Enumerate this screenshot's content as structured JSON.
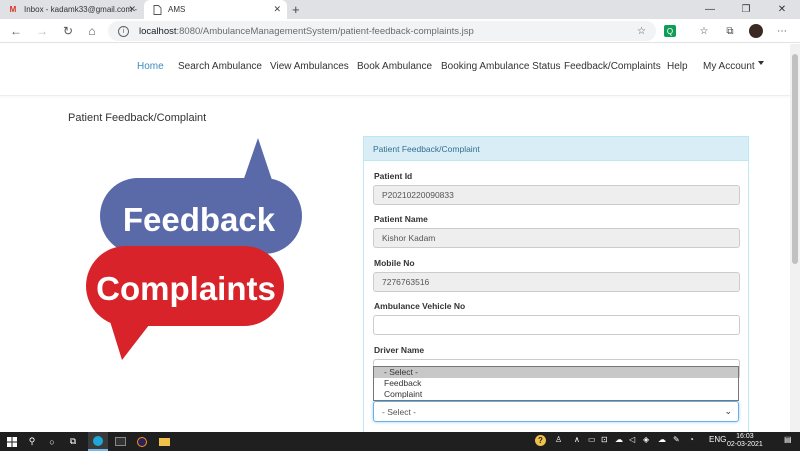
{
  "browser": {
    "tabs": [
      {
        "title": "Inbox - kadamk33@gmail.com -",
        "icon": "gmail-icon",
        "active": false
      },
      {
        "title": "AMS",
        "icon": "page-icon",
        "active": true
      }
    ],
    "url_host": "localhost",
    "url_path": ":8080/AmbulanceManagementSystem/patient-feedback-complaints.jsp"
  },
  "nav": {
    "items": [
      "Home",
      "Search Ambulance",
      "View Ambulances",
      "Book Ambulance",
      "Booking Ambulance Status",
      "Feedback/Complaints",
      "Help",
      "My Account"
    ],
    "active_index": 0
  },
  "page": {
    "title": "Patient Feedback/Complaint"
  },
  "illustration": {
    "line1": "Feedback",
    "line2": "Complaints"
  },
  "form": {
    "panel_title": "Patient Feedback/Complaint",
    "patient_id_label": "Patient Id",
    "patient_id_value": "P20210220090833",
    "patient_name_label": "Patient Name",
    "patient_name_value": "Kishor Kadam",
    "mobile_label": "Mobile No",
    "mobile_value": "7276763516",
    "vehicle_label": "Ambulance Vehicle No",
    "vehicle_value": "",
    "driver_label": "Driver Name",
    "type_options": [
      "- Select -",
      "Feedback",
      "Complaint"
    ],
    "type_selected": "- Select -"
  },
  "taskbar": {
    "language": "ENG",
    "time": "16:03",
    "date": "02-03-2021"
  },
  "colors": {
    "accent": "#3c8dbc",
    "panel_head_bg": "#d9edf7",
    "panel_head_text": "#31708f",
    "feedback_blue": "#5a6aa8",
    "complaint_red": "#d8232a"
  }
}
